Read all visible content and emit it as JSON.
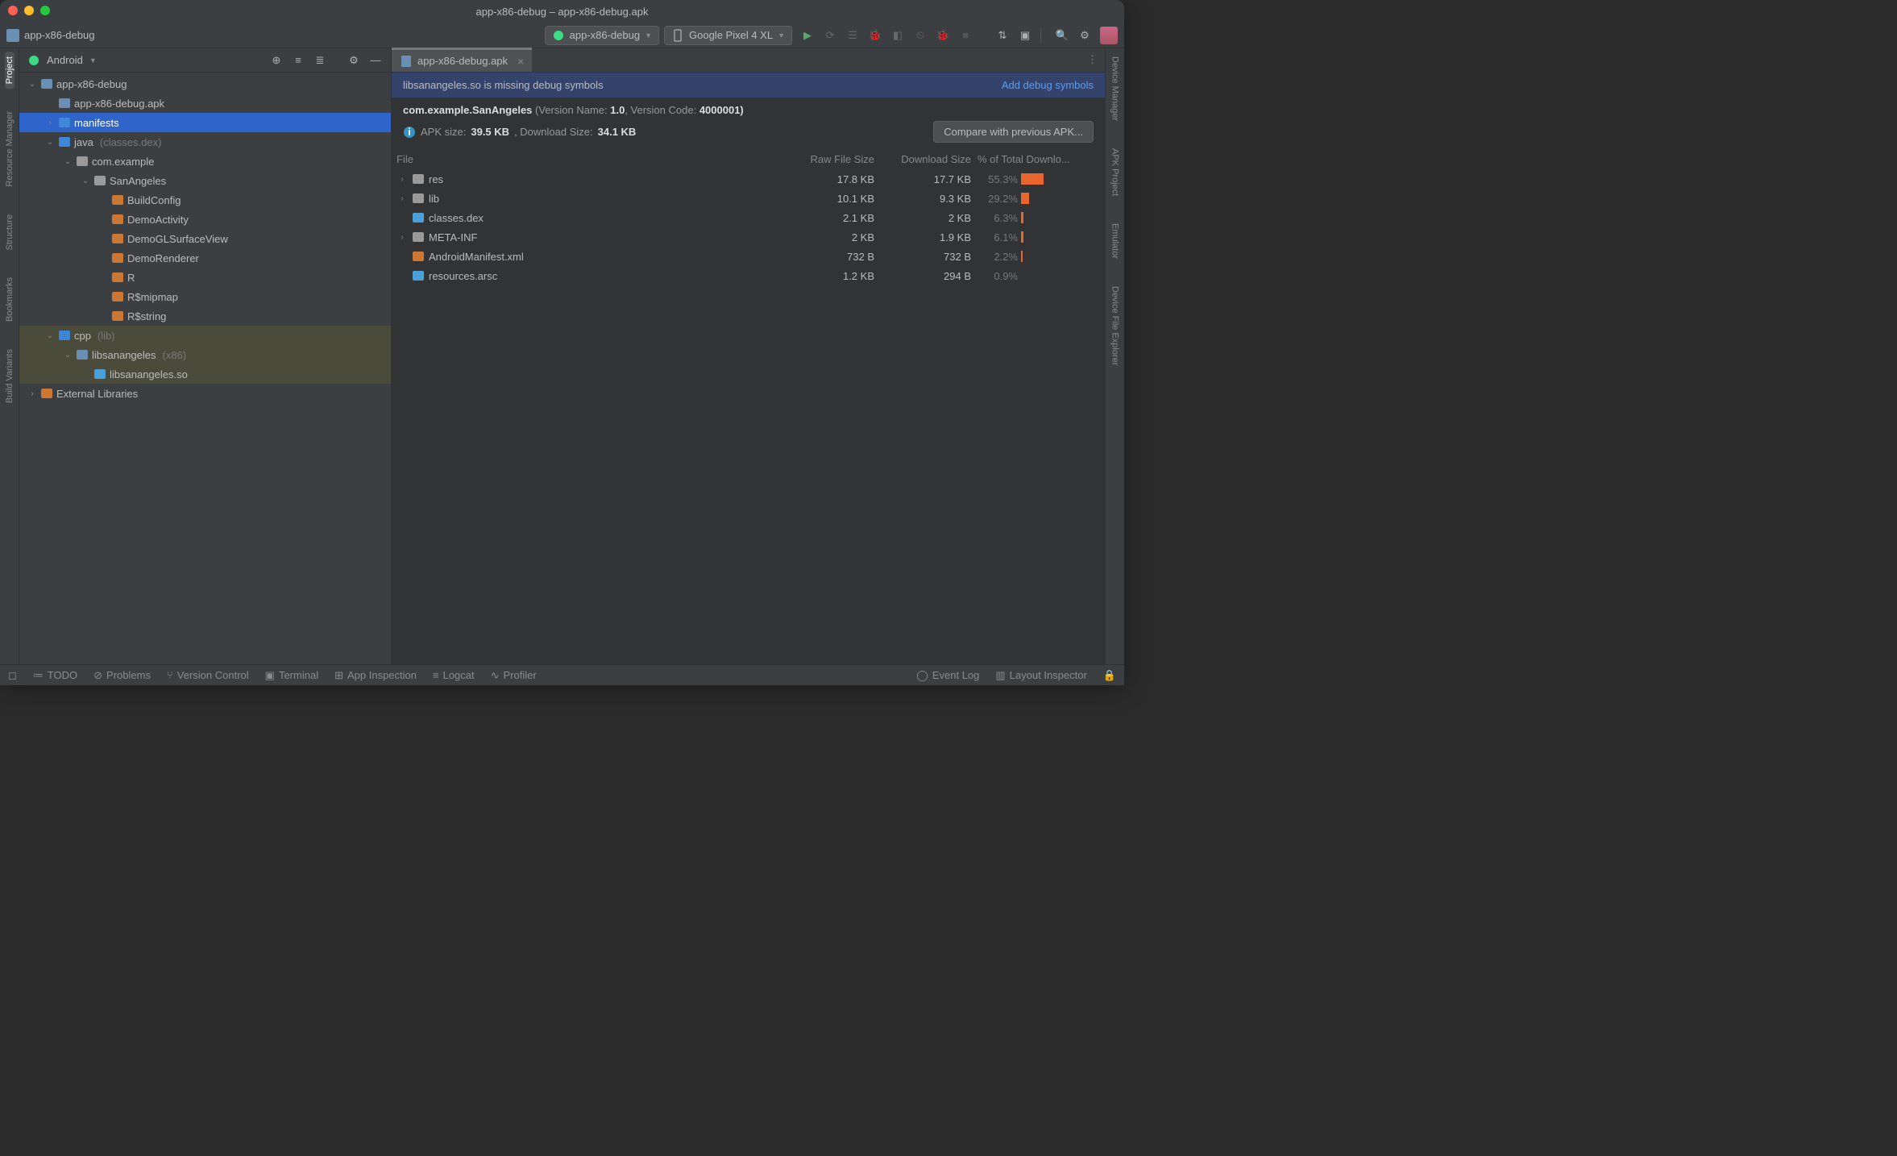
{
  "window": {
    "title": "app-x86-debug – app-x86-debug.apk"
  },
  "breadcrumb": {
    "root": "app-x86-debug"
  },
  "toolbar": {
    "config": "app-x86-debug",
    "device": "Google Pixel 4 XL"
  },
  "leftTools": [
    {
      "label": "Project",
      "sel": true
    },
    {
      "label": "Resource Manager",
      "sel": false
    },
    {
      "label": "Structure",
      "sel": false
    },
    {
      "label": "Bookmarks",
      "sel": false
    },
    {
      "label": "Build Variants",
      "sel": false
    }
  ],
  "rightTools": [
    {
      "label": "Device Manager"
    },
    {
      "label": "APK Project"
    },
    {
      "label": "Emulator"
    },
    {
      "label": "Device File Explorer"
    }
  ],
  "projectPanel": {
    "view": "Android"
  },
  "tree": [
    {
      "depth": 0,
      "exp": "v",
      "icon": "module",
      "label": "app-x86-debug",
      "sel": false
    },
    {
      "depth": 1,
      "exp": "",
      "icon": "apk",
      "label": "app-x86-debug.apk",
      "sel": false
    },
    {
      "depth": 1,
      "exp": ">",
      "icon": "folder-blue",
      "label": "manifests",
      "sel": true
    },
    {
      "depth": 1,
      "exp": "v",
      "icon": "folder-blue",
      "label": "java",
      "dim": "(classes.dex)",
      "sel": false
    },
    {
      "depth": 2,
      "exp": "v",
      "icon": "pkg",
      "label": "com.example",
      "sel": false
    },
    {
      "depth": 3,
      "exp": "v",
      "icon": "pkg",
      "label": "SanAngeles",
      "sel": false
    },
    {
      "depth": 4,
      "exp": "",
      "icon": "class",
      "label": "BuildConfig",
      "sel": false
    },
    {
      "depth": 4,
      "exp": "",
      "icon": "class",
      "label": "DemoActivity",
      "sel": false
    },
    {
      "depth": 4,
      "exp": "",
      "icon": "class",
      "label": "DemoGLSurfaceView",
      "sel": false
    },
    {
      "depth": 4,
      "exp": "",
      "icon": "class",
      "label": "DemoRenderer",
      "sel": false
    },
    {
      "depth": 4,
      "exp": "",
      "icon": "class",
      "label": "R",
      "sel": false
    },
    {
      "depth": 4,
      "exp": "",
      "icon": "class",
      "label": "R$mipmap",
      "sel": false
    },
    {
      "depth": 4,
      "exp": "",
      "icon": "class",
      "label": "R$string",
      "sel": false
    },
    {
      "depth": 1,
      "exp": "v",
      "icon": "folder-blue",
      "label": "cpp",
      "dim": "(lib)",
      "hl": true
    },
    {
      "depth": 2,
      "exp": "v",
      "icon": "native",
      "label": "libsanangeles",
      "dim": "(x86)",
      "hl": true
    },
    {
      "depth": 3,
      "exp": "",
      "icon": "so",
      "label": "libsanangeles.so",
      "hl": true
    },
    {
      "depth": 0,
      "exp": ">",
      "icon": "libs",
      "label": "External Libraries",
      "sel": false
    }
  ],
  "editorTab": {
    "label": "app-x86-debug.apk"
  },
  "banner": {
    "msg": "libsanangeles.so is missing debug symbols",
    "action": "Add debug symbols"
  },
  "apkInfo": {
    "package": "com.example.SanAngeles",
    "versionNameLabel": "(Version Name: ",
    "versionName": "1.0",
    "versionCodeLabel": ", Version Code: ",
    "versionCode": "4000001)",
    "sizeLabel": "APK size: ",
    "apkSize": "39.5 KB",
    "dlLabel": ", Download Size: ",
    "dlSize": "34.1 KB",
    "compareBtn": "Compare with previous APK..."
  },
  "gridHeaders": {
    "file": "File",
    "raw": "Raw File Size",
    "dl": "Download Size",
    "pct": "% of Total Downlo..."
  },
  "files": [
    {
      "exp": ">",
      "icon": "folder",
      "name": "res",
      "raw": "17.8 KB",
      "dl": "17.7 KB",
      "pct": "55.3%",
      "bar": 28
    },
    {
      "exp": ">",
      "icon": "folder",
      "name": "lib",
      "raw": "10.1 KB",
      "dl": "9.3 KB",
      "pct": "29.2%",
      "bar": 10
    },
    {
      "exp": "",
      "icon": "dex",
      "name": "classes.dex",
      "raw": "2.1 KB",
      "dl": "2 KB",
      "pct": "6.3%",
      "bar": 3
    },
    {
      "exp": ">",
      "icon": "folder",
      "name": "META-INF",
      "raw": "2 KB",
      "dl": "1.9 KB",
      "pct": "6.1%",
      "bar": 3
    },
    {
      "exp": "",
      "icon": "xml",
      "name": "AndroidManifest.xml",
      "raw": "732 B",
      "dl": "732 B",
      "pct": "2.2%",
      "bar": 2
    },
    {
      "exp": "",
      "icon": "arsc",
      "name": "resources.arsc",
      "raw": "1.2 KB",
      "dl": "294 B",
      "pct": "0.9%",
      "bar": 0
    }
  ],
  "status": {
    "todo": "TODO",
    "problems": "Problems",
    "vcs": "Version Control",
    "terminal": "Terminal",
    "appinsp": "App Inspection",
    "logcat": "Logcat",
    "profiler": "Profiler",
    "eventlog": "Event Log",
    "layout": "Layout Inspector"
  }
}
